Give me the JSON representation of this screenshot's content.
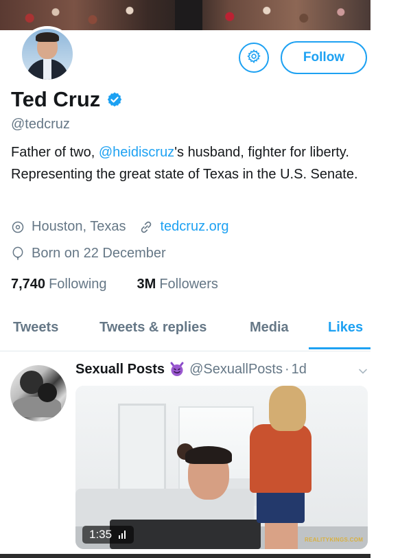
{
  "profile": {
    "name": "Ted Cruz",
    "handle": "@tedcruz",
    "bio_before": "Father of two, ",
    "bio_mention": "@heidiscruz",
    "bio_after": "'s husband, fighter for liberty. Representing the great state of Texas in the U.S. Senate.",
    "location": "Houston, Texas",
    "website": "tedcruz.org",
    "birthday": "Born on 22 December",
    "following_count": "7,740",
    "following_label": "Following",
    "followers_count": "3M",
    "followers_label": "Followers",
    "verified": true
  },
  "actions": {
    "settings_icon": "gear-icon",
    "follow_label": "Follow"
  },
  "tabs": [
    {
      "label": "Tweets",
      "active": false
    },
    {
      "label": "Tweets & replies",
      "active": false
    },
    {
      "label": "Media",
      "active": false
    },
    {
      "label": "Likes",
      "active": true
    }
  ],
  "tweet": {
    "author_name": "Sexuall Posts",
    "author_emoji": "smiling-devil-emoji",
    "author_handle": "@SexuallPosts",
    "separator": "·",
    "time": "1d",
    "media": {
      "duration": "1:35",
      "watermark": "REALITYKINGS.COM"
    }
  },
  "colors": {
    "accent": "#1da1f2",
    "text_primary": "#14171a",
    "text_secondary": "#657786",
    "divider": "#e1e8ed"
  }
}
